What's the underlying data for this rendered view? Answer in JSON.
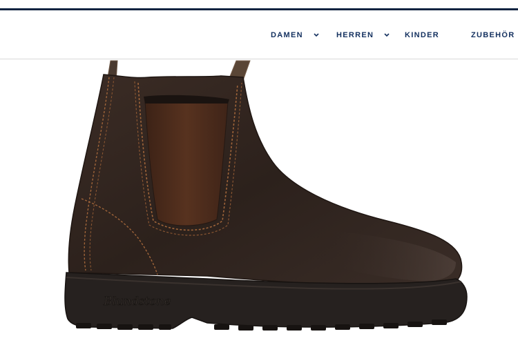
{
  "header": {
    "nav": [
      {
        "label": "DAMEN",
        "has_dropdown": true,
        "icon": "chevron-down-icon"
      },
      {
        "label": "HERREN",
        "has_dropdown": true,
        "icon": "chevron-down-icon"
      },
      {
        "label": "KINDER",
        "has_dropdown": false
      },
      {
        "label": "ZUBEHÖR",
        "has_dropdown": false
      }
    ]
  },
  "product": {
    "image": "boot-image",
    "brand_mark": "Blundstone"
  },
  "colors": {
    "nav_text": "#13305f",
    "top_border": "#0e2340",
    "boot_leather": "#2f231e",
    "boot_elastic": "#4a2a1a",
    "boot_stitch": "#a0653a",
    "boot_sole": "#26211f"
  }
}
